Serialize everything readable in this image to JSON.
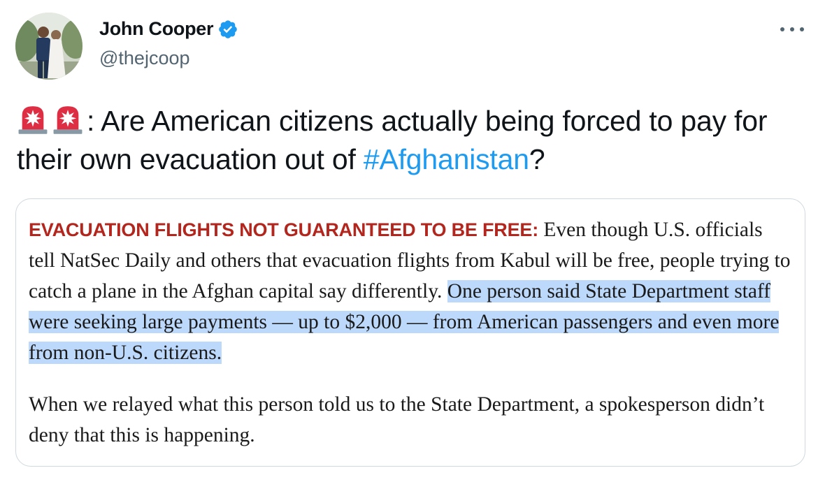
{
  "author": {
    "display_name": "John Cooper",
    "handle": "@thejcoop",
    "verified_icon": "verified-badge-icon",
    "avatar_icon": "avatar"
  },
  "menu": {
    "more_icon": "more-dots-icon"
  },
  "tweet": {
    "emoji_icons": [
      "siren-icon",
      "siren-icon"
    ],
    "text_before": ": Are American citizens actually being forced to pay for their own evacuation out of ",
    "hashtag": "#Afghanistan",
    "text_after": "?"
  },
  "screenshot_card": {
    "lead_in": "EVACUATION FLIGHTS NOT GUARANTEED TO BE FREE:",
    "para1_plain": " Even though U.S. officials tell NatSec Daily and others that evacuation flights from Kabul will be free, people trying to catch a plane in the Afghan capital say differently. ",
    "para1_highlighted": "One person said State Department staff were seeking large payments — up to $2,000 — from American passengers and even more from non-U.S. citizens.",
    "para2": "When we relayed what this person told us to the State Department, a spokesperson didn’t deny that this is happening."
  },
  "colors": {
    "link": "#1d9bf0",
    "lead_in": "#b3261e",
    "highlight": "#bcd8fb",
    "secondary_text": "#536471"
  }
}
